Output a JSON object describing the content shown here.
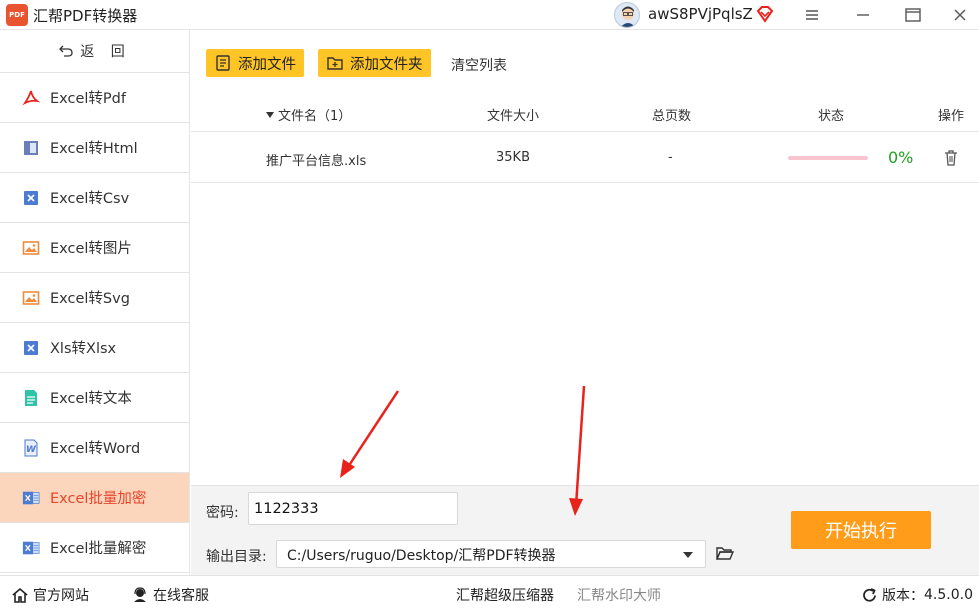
{
  "app": {
    "logo_text": "PDF",
    "title": "汇帮PDF转换器",
    "username": "awS8PVjPqlsZ"
  },
  "window": {
    "menu_icon": "hamburger-icon",
    "min_icon": "minimize-icon",
    "max_icon": "maximize-icon",
    "close_icon": "close-icon"
  },
  "sidebar": {
    "back_label": "返 回",
    "items": [
      {
        "label": "Excel转Pdf",
        "icon": "pdf-icon"
      },
      {
        "label": "Excel转Html",
        "icon": "html-icon"
      },
      {
        "label": "Excel转Csv",
        "icon": "excel-icon"
      },
      {
        "label": "Excel转图片",
        "icon": "image-icon"
      },
      {
        "label": "Excel转Svg",
        "icon": "image-icon"
      },
      {
        "label": "Xls转Xlsx",
        "icon": "excel-icon"
      },
      {
        "label": "Excel转文本",
        "icon": "text-icon"
      },
      {
        "label": "Excel转Word",
        "icon": "word-icon"
      },
      {
        "label": "Excel批量加密",
        "icon": "excel-lock-icon",
        "active": true
      },
      {
        "label": "Excel批量解密",
        "icon": "excel-unlock-icon"
      }
    ]
  },
  "toolbar": {
    "add_file": "添加文件",
    "add_folder": "添加文件夹",
    "clear_list": "清空列表"
  },
  "table": {
    "headers": {
      "name": "文件名（1）",
      "size": "文件大小",
      "pages": "总页数",
      "status": "状态",
      "action": "操作"
    },
    "rows": [
      {
        "name": "推广平台信息.xls",
        "size": "35KB",
        "pages": "-",
        "progress": 0,
        "percent": "0%"
      }
    ]
  },
  "settings": {
    "password_label": "密码:",
    "password_value": "1122333",
    "output_label": "输出目录:",
    "output_path": "C:/Users/ruguo/Desktop/汇帮PDF转换器",
    "start_label": "开始执行"
  },
  "footer": {
    "website": "官方网站",
    "support": "在线客服",
    "compressor": "汇帮超级压缩器",
    "watermark": "汇帮水印大师",
    "version_label": "版本：",
    "version": "4.5.0.0"
  },
  "colors": {
    "accent": "#ffc526",
    "start": "#ff9d1a",
    "active_bg": "#fcd5bd",
    "active_text": "#e8452a",
    "arrow": "#e8231b"
  }
}
